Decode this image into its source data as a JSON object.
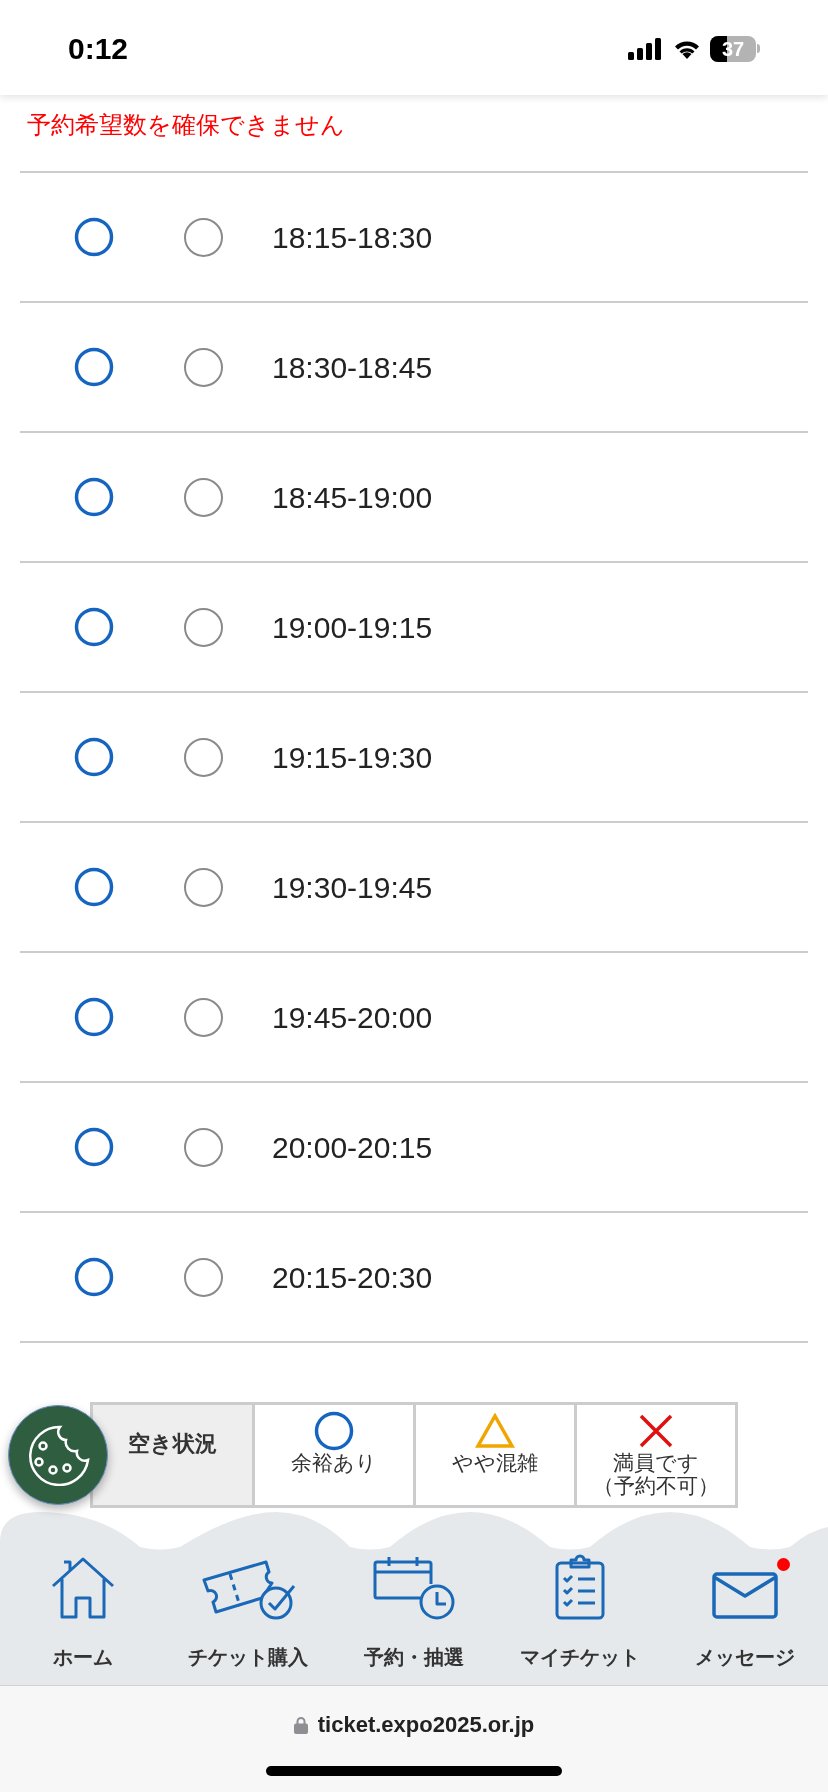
{
  "status_bar": {
    "time": "0:12",
    "battery": "37"
  },
  "error_message": "予約希望数を確保できません",
  "slots": [
    {
      "kind": "available",
      "selected": false,
      "time": "18:15-18:30"
    },
    {
      "kind": "available",
      "selected": false,
      "time": "18:30-18:45"
    },
    {
      "kind": "available",
      "selected": false,
      "time": "18:45-19:00"
    },
    {
      "kind": "available",
      "selected": false,
      "time": "19:00-19:15"
    },
    {
      "kind": "available",
      "selected": false,
      "time": "19:15-19:30"
    },
    {
      "kind": "available",
      "selected": false,
      "time": "19:30-19:45"
    },
    {
      "kind": "available",
      "selected": false,
      "time": "19:45-20:00"
    },
    {
      "kind": "available",
      "selected": false,
      "time": "20:00-20:15"
    },
    {
      "kind": "available",
      "selected": false,
      "time": "20:15-20:30"
    }
  ],
  "legend": {
    "title": "空き状況",
    "items": [
      {
        "kind": "available",
        "label": "余裕あり"
      },
      {
        "kind": "crowded",
        "label": "やや混雑"
      },
      {
        "kind": "full",
        "label": "満員です",
        "note": "（予約不可）"
      }
    ]
  },
  "nav": [
    {
      "kind": "home",
      "label": "ホーム",
      "badge": false
    },
    {
      "kind": "ticket",
      "label": "チケット購入",
      "badge": false
    },
    {
      "kind": "reserve",
      "label": "予約・抽選",
      "badge": false
    },
    {
      "kind": "mytickets",
      "label": "マイチケット",
      "badge": false
    },
    {
      "kind": "messages",
      "label": "メッセージ",
      "badge": true
    }
  ],
  "url_bar": {
    "url": "ticket.expo2025.or.jp"
  }
}
